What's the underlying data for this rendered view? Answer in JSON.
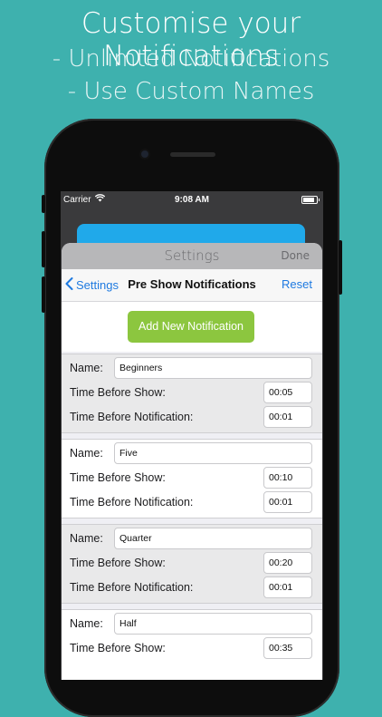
{
  "promo": {
    "headline": "Customise your Notifications",
    "line1": "- Unlimted Notifications",
    "line2": "- Use Custom Names"
  },
  "status_bar": {
    "carrier": "Carrier",
    "time": "9:08 AM"
  },
  "sheet": {
    "title": "Settings",
    "done": "Done"
  },
  "nav": {
    "back": "Settings",
    "title": "Pre Show Notifications",
    "reset": "Reset"
  },
  "add_button": "Add New Notification",
  "labels": {
    "name": "Name:",
    "before_show": "Time Before Show:",
    "before_notification": "Time Before Notification:"
  },
  "notifications": [
    {
      "name": "Beginners",
      "before_show": "00:05",
      "before_notification": "00:01"
    },
    {
      "name": "Five",
      "before_show": "00:10",
      "before_notification": "00:01"
    },
    {
      "name": "Quarter",
      "before_show": "00:20",
      "before_notification": "00:01"
    },
    {
      "name": "Half",
      "before_show": "00:35",
      "before_notification": ""
    }
  ],
  "colors": {
    "background": "#3eb1ae",
    "accent_green": "#8cc63f",
    "ios_blue": "#1f7ae0"
  }
}
